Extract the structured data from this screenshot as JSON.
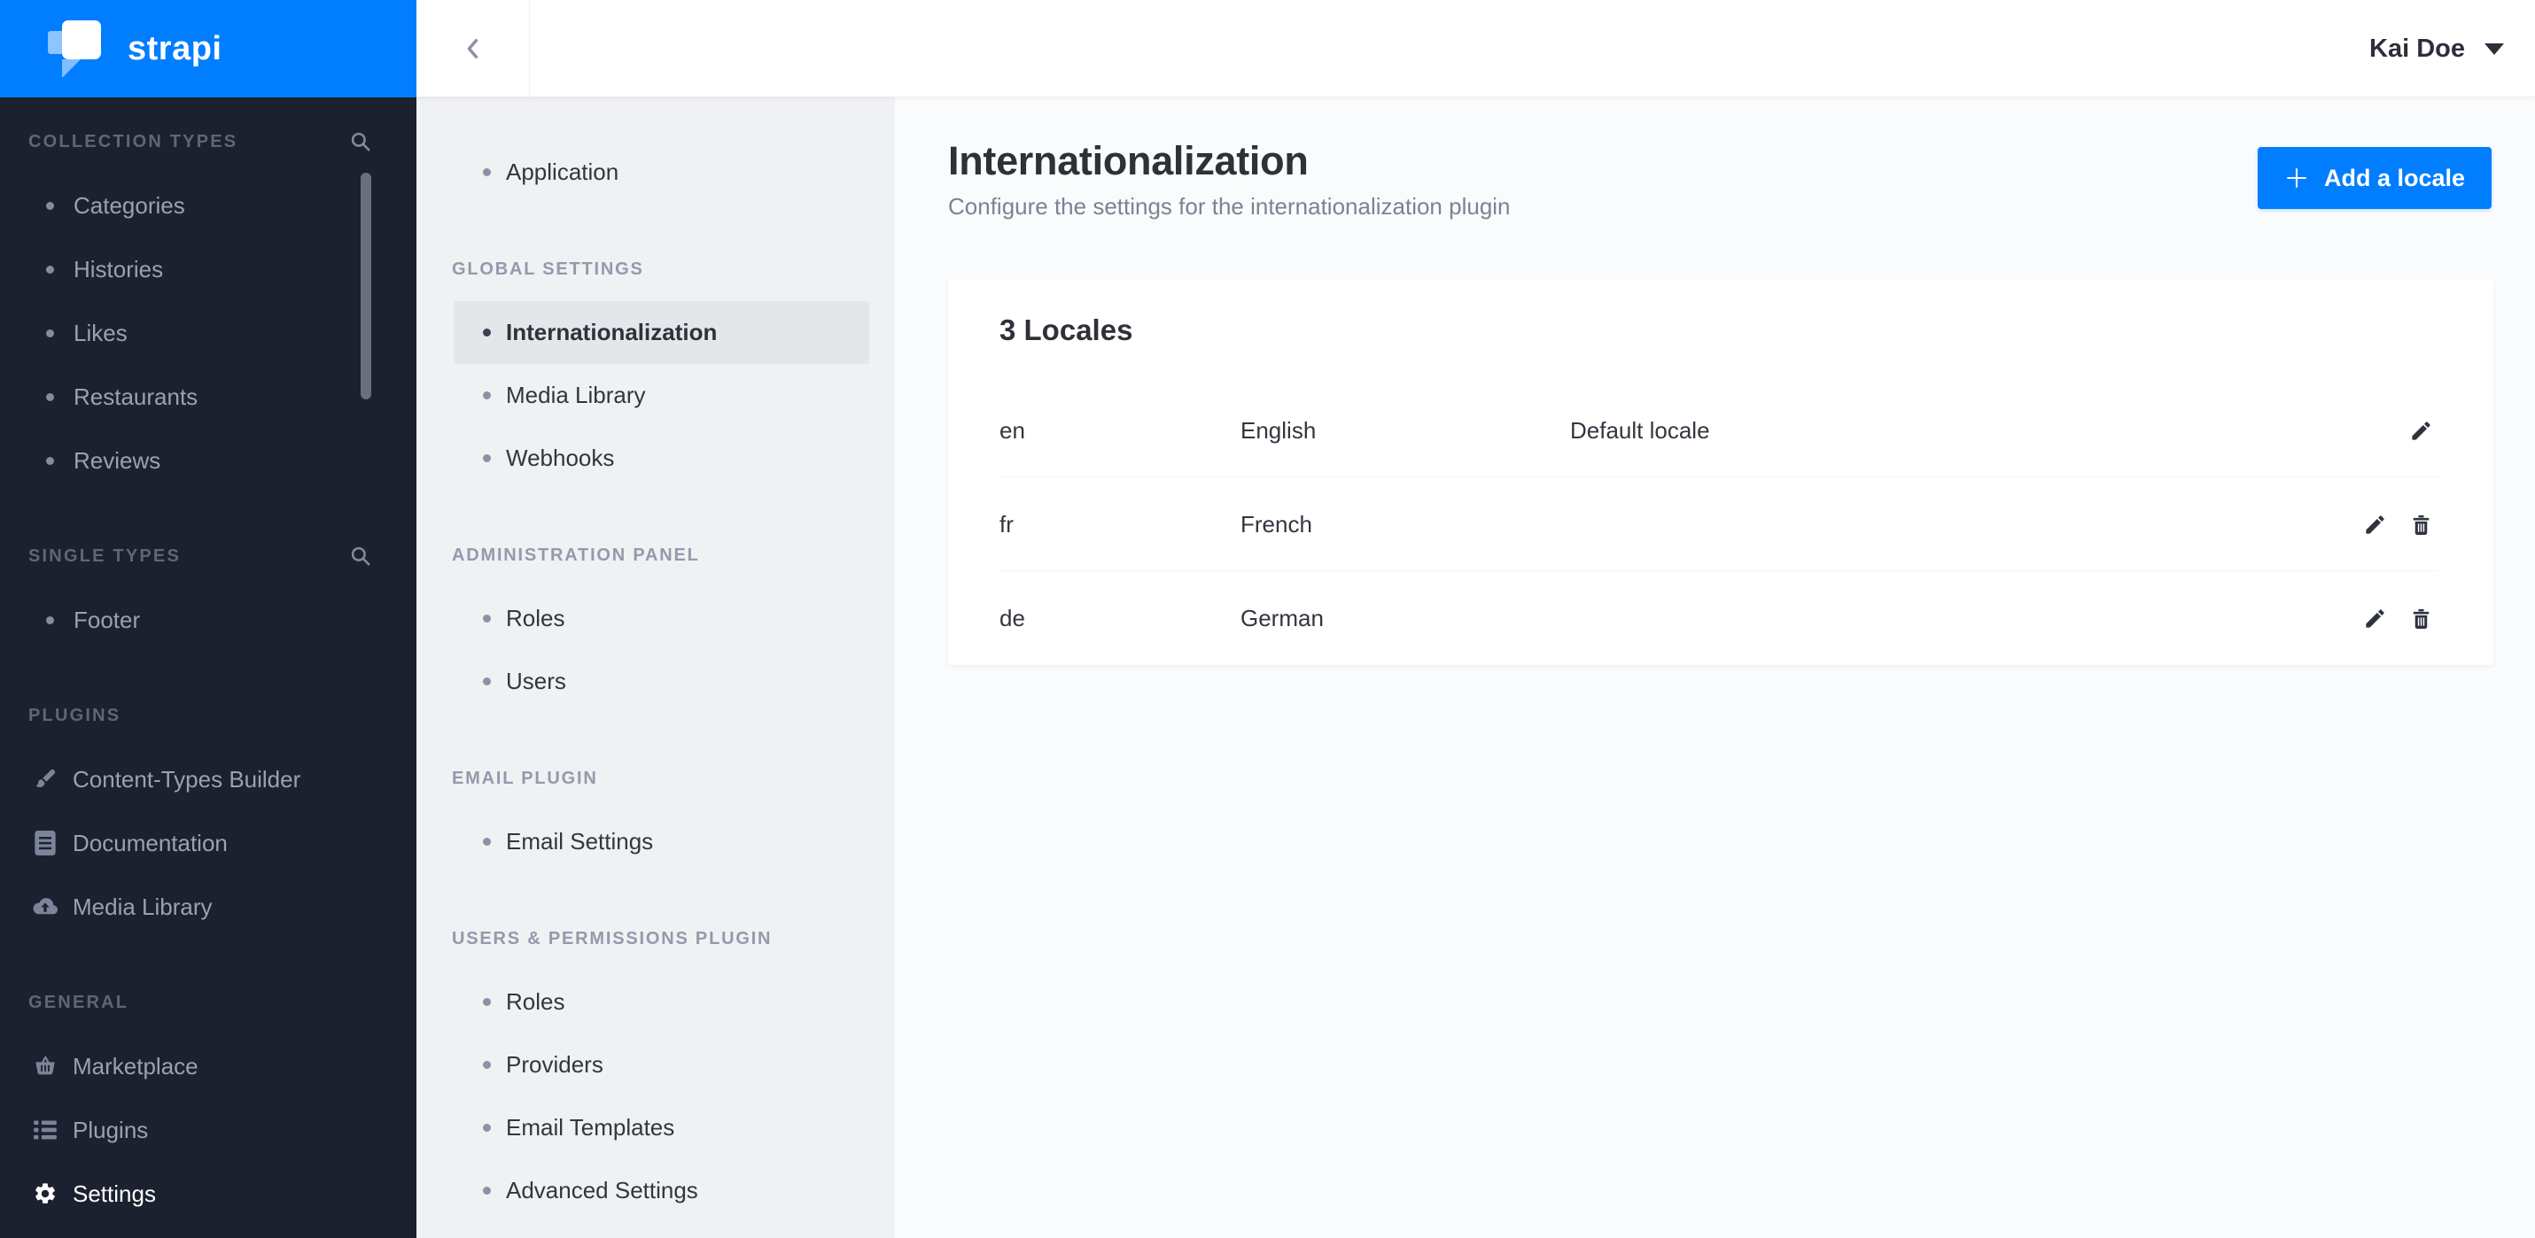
{
  "brand": {
    "logo_text": "strapi",
    "accent_color": "#007eff",
    "sidebar_color": "#1b212e"
  },
  "topbar": {
    "user_name": "Kai Doe",
    "back_icon": "chevron-left-icon",
    "user_caret_icon": "chevron-down-icon"
  },
  "sidebar": {
    "sections": [
      {
        "label": "COLLECTION TYPES",
        "search_icon": "search-icon",
        "items": [
          {
            "label": "Categories"
          },
          {
            "label": "Histories"
          },
          {
            "label": "Likes"
          },
          {
            "label": "Restaurants"
          },
          {
            "label": "Reviews"
          }
        ]
      },
      {
        "label": "SINGLE TYPES",
        "search_icon": "search-icon",
        "items": [
          {
            "label": "Footer"
          }
        ]
      },
      {
        "label": "PLUGINS",
        "items": [
          {
            "label": "Content-Types Builder",
            "icon": "paintbrush-icon"
          },
          {
            "label": "Documentation",
            "icon": "book-icon"
          },
          {
            "label": "Media Library",
            "icon": "cloud-upload-icon"
          }
        ]
      },
      {
        "label": "GENERAL",
        "items": [
          {
            "label": "Marketplace",
            "icon": "basket-icon"
          },
          {
            "label": "Plugins",
            "icon": "list-icon"
          },
          {
            "label": "Settings",
            "icon": "gear-icon",
            "active": true
          }
        ]
      }
    ]
  },
  "settings_nav": {
    "groups": [
      {
        "label": "",
        "items": [
          {
            "label": "Application"
          }
        ]
      },
      {
        "label": "GLOBAL SETTINGS",
        "items": [
          {
            "label": "Internationalization",
            "active": true
          },
          {
            "label": "Media Library"
          },
          {
            "label": "Webhooks"
          }
        ]
      },
      {
        "label": "ADMINISTRATION PANEL",
        "items": [
          {
            "label": "Roles"
          },
          {
            "label": "Users"
          }
        ]
      },
      {
        "label": "EMAIL PLUGIN",
        "items": [
          {
            "label": "Email Settings"
          }
        ]
      },
      {
        "label": "USERS & PERMISSIONS PLUGIN",
        "items": [
          {
            "label": "Roles"
          },
          {
            "label": "Providers"
          },
          {
            "label": "Email Templates"
          },
          {
            "label": "Advanced Settings"
          }
        ]
      }
    ]
  },
  "page": {
    "title": "Internationalization",
    "subtitle": "Configure the settings for the internationalization plugin",
    "add_button": {
      "label": "Add a locale",
      "icon": "plus-icon"
    }
  },
  "locales_card": {
    "title": "3 Locales",
    "rows": [
      {
        "code": "en",
        "name": "English",
        "note": "Default locale",
        "actions": [
          "edit"
        ]
      },
      {
        "code": "fr",
        "name": "French",
        "note": "",
        "actions": [
          "edit",
          "delete"
        ]
      },
      {
        "code": "de",
        "name": "German",
        "note": "",
        "actions": [
          "edit",
          "delete"
        ]
      }
    ]
  }
}
